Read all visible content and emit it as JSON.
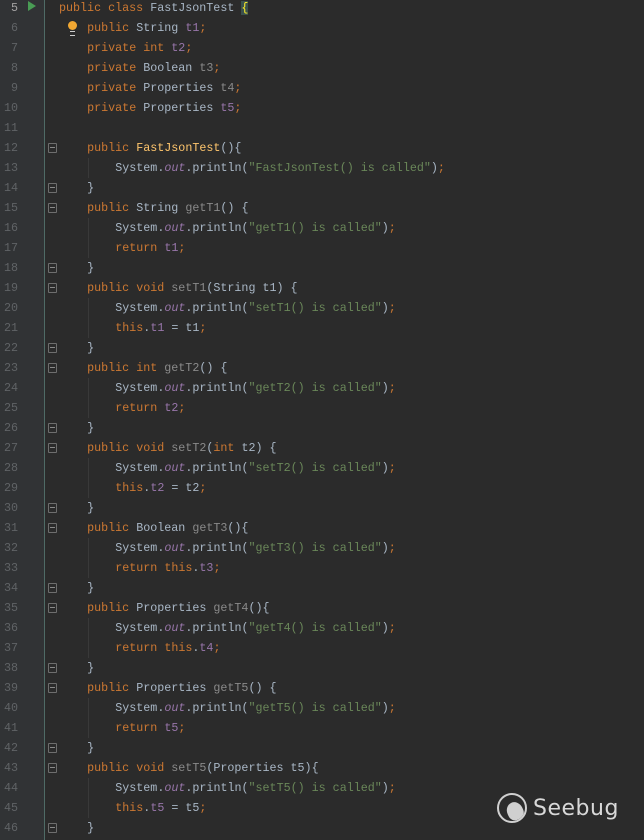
{
  "editor": {
    "current_line": 5,
    "lines": [
      {
        "n": "5",
        "indent": 0,
        "tokens": [
          [
            "public class ",
            "k"
          ],
          [
            "FastJsonTest ",
            "t"
          ],
          [
            "{",
            "b"
          ]
        ]
      },
      {
        "n": "6",
        "indent": 4,
        "tokens": [
          [
            "public ",
            "k"
          ],
          [
            "String ",
            "t"
          ],
          [
            "t1",
            "f"
          ],
          [
            ";",
            "k"
          ]
        ]
      },
      {
        "n": "7",
        "indent": 4,
        "tokens": [
          [
            "private int ",
            "k"
          ],
          [
            "t2",
            "f"
          ],
          [
            ";",
            "k"
          ]
        ]
      },
      {
        "n": "8",
        "indent": 4,
        "tokens": [
          [
            "private ",
            "k"
          ],
          [
            "Boolean ",
            "t"
          ],
          [
            "t3",
            "u"
          ],
          [
            ";",
            "k"
          ]
        ]
      },
      {
        "n": "9",
        "indent": 4,
        "tokens": [
          [
            "private ",
            "k"
          ],
          [
            "Properties ",
            "t"
          ],
          [
            "t4",
            "u"
          ],
          [
            ";",
            "k"
          ]
        ]
      },
      {
        "n": "10",
        "indent": 4,
        "tokens": [
          [
            "private ",
            "k"
          ],
          [
            "Properties ",
            "t"
          ],
          [
            "t5",
            "f"
          ],
          [
            ";",
            "k"
          ]
        ]
      },
      {
        "n": "11",
        "indent": 0,
        "tokens": []
      },
      {
        "n": "12",
        "indent": 4,
        "fold": true,
        "tokens": [
          [
            "public ",
            "k"
          ],
          [
            "FastJsonTest",
            "m"
          ],
          [
            "(){",
            "t"
          ]
        ]
      },
      {
        "n": "13",
        "indent": 8,
        "tokens": [
          [
            "System.",
            "t"
          ],
          [
            "out",
            "o"
          ],
          [
            ".println(",
            "t"
          ],
          [
            "\"FastJsonTest() is called\"",
            "s"
          ],
          [
            ")",
            "t"
          ],
          [
            ";",
            "k"
          ]
        ]
      },
      {
        "n": "14",
        "indent": 4,
        "fold": true,
        "tokens": [
          [
            "}",
            "t"
          ]
        ]
      },
      {
        "n": "15",
        "indent": 4,
        "fold": true,
        "tokens": [
          [
            "public ",
            "k"
          ],
          [
            "String ",
            "t"
          ],
          [
            "getT1",
            "u"
          ],
          [
            "() {",
            "t"
          ]
        ]
      },
      {
        "n": "16",
        "indent": 8,
        "tokens": [
          [
            "System.",
            "t"
          ],
          [
            "out",
            "o"
          ],
          [
            ".println(",
            "t"
          ],
          [
            "\"getT1() is called\"",
            "s"
          ],
          [
            ")",
            "t"
          ],
          [
            ";",
            "k"
          ]
        ]
      },
      {
        "n": "17",
        "indent": 8,
        "tokens": [
          [
            "return ",
            "k"
          ],
          [
            "t1",
            "f"
          ],
          [
            ";",
            "k"
          ]
        ]
      },
      {
        "n": "18",
        "indent": 4,
        "fold": true,
        "tokens": [
          [
            "}",
            "t"
          ]
        ]
      },
      {
        "n": "19",
        "indent": 4,
        "fold": true,
        "tokens": [
          [
            "public void ",
            "k"
          ],
          [
            "setT1",
            "u"
          ],
          [
            "(String t1) {",
            "t"
          ]
        ]
      },
      {
        "n": "20",
        "indent": 8,
        "tokens": [
          [
            "System.",
            "t"
          ],
          [
            "out",
            "o"
          ],
          [
            ".println(",
            "t"
          ],
          [
            "\"setT1() is called\"",
            "s"
          ],
          [
            ")",
            "t"
          ],
          [
            ";",
            "k"
          ]
        ]
      },
      {
        "n": "21",
        "indent": 8,
        "tokens": [
          [
            "this",
            "k"
          ],
          [
            ".",
            "t"
          ],
          [
            "t1",
            "f"
          ],
          [
            " = t1",
            "t"
          ],
          [
            ";",
            "k"
          ]
        ]
      },
      {
        "n": "22",
        "indent": 4,
        "fold": true,
        "tokens": [
          [
            "}",
            "t"
          ]
        ]
      },
      {
        "n": "23",
        "indent": 4,
        "fold": true,
        "tokens": [
          [
            "public int ",
            "k"
          ],
          [
            "getT2",
            "u"
          ],
          [
            "() {",
            "t"
          ]
        ]
      },
      {
        "n": "24",
        "indent": 8,
        "tokens": [
          [
            "System.",
            "t"
          ],
          [
            "out",
            "o"
          ],
          [
            ".println(",
            "t"
          ],
          [
            "\"getT2() is called\"",
            "s"
          ],
          [
            ")",
            "t"
          ],
          [
            ";",
            "k"
          ]
        ]
      },
      {
        "n": "25",
        "indent": 8,
        "tokens": [
          [
            "return ",
            "k"
          ],
          [
            "t2",
            "f"
          ],
          [
            ";",
            "k"
          ]
        ]
      },
      {
        "n": "26",
        "indent": 4,
        "fold": true,
        "tokens": [
          [
            "}",
            "t"
          ]
        ]
      },
      {
        "n": "27",
        "indent": 4,
        "fold": true,
        "tokens": [
          [
            "public void ",
            "k"
          ],
          [
            "setT2",
            "u"
          ],
          [
            "(",
            "t"
          ],
          [
            "int ",
            "k"
          ],
          [
            "t2) {",
            "t"
          ]
        ]
      },
      {
        "n": "28",
        "indent": 8,
        "tokens": [
          [
            "System.",
            "t"
          ],
          [
            "out",
            "o"
          ],
          [
            ".println(",
            "t"
          ],
          [
            "\"setT2() is called\"",
            "s"
          ],
          [
            ")",
            "t"
          ],
          [
            ";",
            "k"
          ]
        ]
      },
      {
        "n": "29",
        "indent": 8,
        "tokens": [
          [
            "this",
            "k"
          ],
          [
            ".",
            "t"
          ],
          [
            "t2",
            "f"
          ],
          [
            " = t2",
            "t"
          ],
          [
            ";",
            "k"
          ]
        ]
      },
      {
        "n": "30",
        "indent": 4,
        "fold": true,
        "tokens": [
          [
            "}",
            "t"
          ]
        ]
      },
      {
        "n": "31",
        "indent": 4,
        "fold": true,
        "tokens": [
          [
            "public ",
            "k"
          ],
          [
            "Boolean ",
            "t"
          ],
          [
            "getT3",
            "u"
          ],
          [
            "(){",
            "t"
          ]
        ]
      },
      {
        "n": "32",
        "indent": 8,
        "tokens": [
          [
            "System.",
            "t"
          ],
          [
            "out",
            "o"
          ],
          [
            ".println(",
            "t"
          ],
          [
            "\"getT3() is called\"",
            "s"
          ],
          [
            ")",
            "t"
          ],
          [
            ";",
            "k"
          ]
        ]
      },
      {
        "n": "33",
        "indent": 8,
        "tokens": [
          [
            "return this",
            "k"
          ],
          [
            ".",
            "t"
          ],
          [
            "t3",
            "f"
          ],
          [
            ";",
            "k"
          ]
        ]
      },
      {
        "n": "34",
        "indent": 4,
        "fold": true,
        "tokens": [
          [
            "}",
            "t"
          ]
        ]
      },
      {
        "n": "35",
        "indent": 4,
        "fold": true,
        "tokens": [
          [
            "public ",
            "k"
          ],
          [
            "Properties ",
            "t"
          ],
          [
            "getT4",
            "u"
          ],
          [
            "(){",
            "t"
          ]
        ]
      },
      {
        "n": "36",
        "indent": 8,
        "tokens": [
          [
            "System.",
            "t"
          ],
          [
            "out",
            "o"
          ],
          [
            ".println(",
            "t"
          ],
          [
            "\"getT4() is called\"",
            "s"
          ],
          [
            ")",
            "t"
          ],
          [
            ";",
            "k"
          ]
        ]
      },
      {
        "n": "37",
        "indent": 8,
        "tokens": [
          [
            "return this",
            "k"
          ],
          [
            ".",
            "t"
          ],
          [
            "t4",
            "f"
          ],
          [
            ";",
            "k"
          ]
        ]
      },
      {
        "n": "38",
        "indent": 4,
        "fold": true,
        "tokens": [
          [
            "}",
            "t"
          ]
        ]
      },
      {
        "n": "39",
        "indent": 4,
        "fold": true,
        "tokens": [
          [
            "public ",
            "k"
          ],
          [
            "Properties ",
            "t"
          ],
          [
            "getT5",
            "u"
          ],
          [
            "() {",
            "t"
          ]
        ]
      },
      {
        "n": "40",
        "indent": 8,
        "tokens": [
          [
            "System.",
            "t"
          ],
          [
            "out",
            "o"
          ],
          [
            ".println(",
            "t"
          ],
          [
            "\"getT5() is called\"",
            "s"
          ],
          [
            ")",
            "t"
          ],
          [
            ";",
            "k"
          ]
        ]
      },
      {
        "n": "41",
        "indent": 8,
        "tokens": [
          [
            "return ",
            "k"
          ],
          [
            "t5",
            "f"
          ],
          [
            ";",
            "k"
          ]
        ]
      },
      {
        "n": "42",
        "indent": 4,
        "fold": true,
        "tokens": [
          [
            "}",
            "t"
          ]
        ]
      },
      {
        "n": "43",
        "indent": 4,
        "fold": true,
        "tokens": [
          [
            "public void ",
            "k"
          ],
          [
            "setT5",
            "u"
          ],
          [
            "(Properties t5){",
            "t"
          ]
        ]
      },
      {
        "n": "44",
        "indent": 8,
        "tokens": [
          [
            "System.",
            "t"
          ],
          [
            "out",
            "o"
          ],
          [
            ".println(",
            "t"
          ],
          [
            "\"setT5() is called\"",
            "s"
          ],
          [
            ")",
            "t"
          ],
          [
            ";",
            "k"
          ]
        ]
      },
      {
        "n": "45",
        "indent": 8,
        "tokens": [
          [
            "this",
            "k"
          ],
          [
            ".",
            "t"
          ],
          [
            "t5",
            "f"
          ],
          [
            " = t5",
            "t"
          ],
          [
            ";",
            "k"
          ]
        ]
      },
      {
        "n": "46",
        "indent": 4,
        "fold": true,
        "tokens": [
          [
            "}",
            "t"
          ]
        ]
      }
    ]
  },
  "watermark": {
    "text": "Seebug"
  },
  "icons": {
    "run": "run-gutter-icon",
    "bulb": "intention-bulb-icon"
  }
}
